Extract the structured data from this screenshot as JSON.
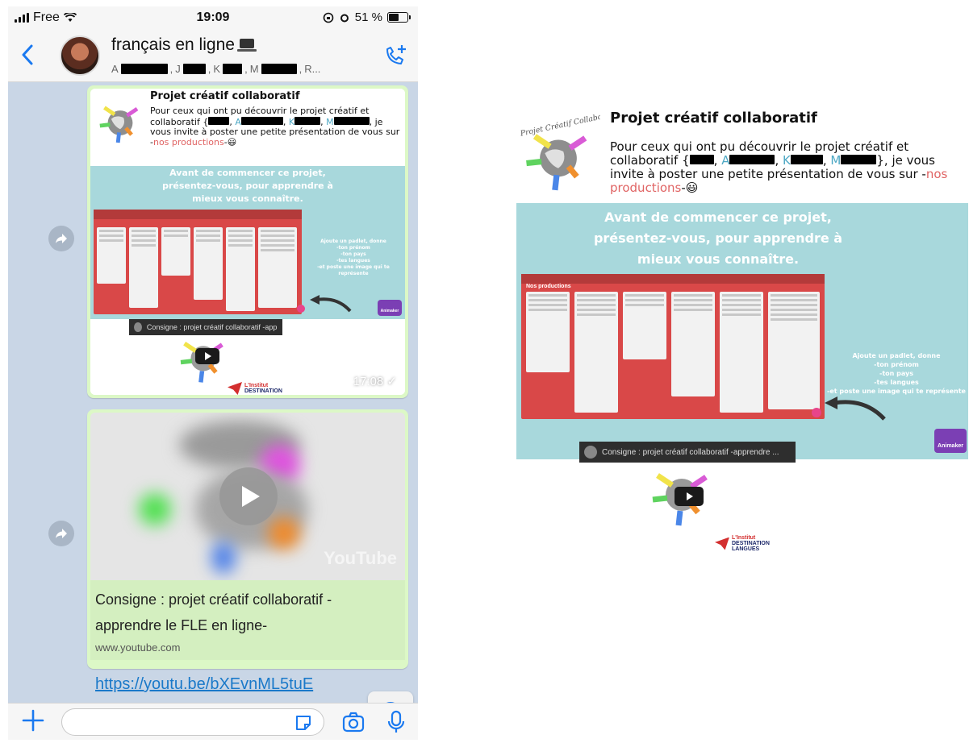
{
  "status_bar": {
    "carrier": "Free",
    "time": "19:09",
    "battery_label": "51 %"
  },
  "header": {
    "back_icon": "chevron-left-icon",
    "title": "français en ligne",
    "members": [
      "A",
      "J",
      "K",
      "M",
      "R..."
    ],
    "call_icon": "add-call-icon"
  },
  "messages": [
    {
      "type": "link-preview",
      "preview": {
        "logo_text": "Projet Créatif Collaboratif",
        "title": "Projet créatif collaboratif",
        "text_1": "Pour ceux qui ont pu découvrir le projet créatif et collaboratif {",
        "members": [
          "A",
          "K",
          "M"
        ],
        "text_2": "je vous invite à poster une petite présentation de vous sur -",
        "link": "nos productions",
        "text_3": "-😃",
        "banner_lines": [
          "Avant de commencer ce projet,",
          "présentez-vous, pour apprendre à",
          "mieux vous connaître."
        ],
        "padlet_title": "Nos productions",
        "side_lines": [
          "Ajoute un padlet, donne",
          "-ton prénom",
          "-ton pays",
          "-tes langues",
          "-et poste une image qui te représente"
        ],
        "animaker": "Animaker",
        "yt_title": "Consigne : projet créatif collaboratif -apprendre ...",
        "destination": [
          "L'Institut",
          "DESTINATION",
          "LANGUES"
        ]
      },
      "time": "17:08 ✓"
    },
    {
      "type": "youtube-link",
      "watermark": "YouTube",
      "link_title": "Consigne : projet créatif collaboratif - apprendre le FLE en ligne-",
      "domain": "www.youtube.com",
      "url": "https://youtu.be/bXEvnML5tuE"
    }
  ],
  "input_bar": {
    "placeholder": ""
  },
  "colors": {
    "bubble": "#dcf8c6",
    "chat_bg": "#c9d6e6",
    "teal_banner": "#a8d8dc",
    "link": "#1a79c9",
    "padlet_red": "#d94848"
  }
}
